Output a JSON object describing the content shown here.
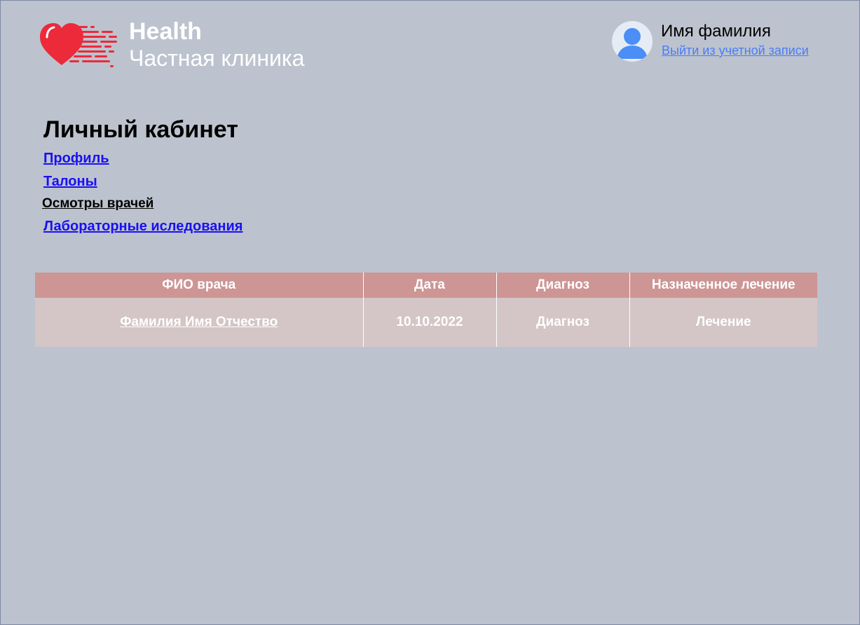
{
  "brand": {
    "title": "Health",
    "subtitle": "Частная клиника",
    "logo_color": "#ec2a3a"
  },
  "user": {
    "name": "Имя фамилия",
    "logout_label": "Выйти из учетной записи"
  },
  "cabinet": {
    "title": "Личный кабинет",
    "nav": {
      "profile": "Профиль",
      "tickets": "Талоны",
      "exams": "Осмотры врачей",
      "labs": "Лабораторные иследования"
    }
  },
  "table": {
    "headers": [
      "ФИО врача",
      "Дата",
      "Диагноз",
      "Назначенное лечение"
    ],
    "rows": [
      [
        "Фамилия Имя Отчество",
        "10.10.2022",
        "Диагноз",
        "Лечение"
      ]
    ]
  },
  "colors": {
    "background": "#bcc3ce",
    "header_row": "#cd9594",
    "body_row": "#d4c5c7",
    "link": "#1a10f2",
    "logout_link": "#4a7cf7"
  }
}
